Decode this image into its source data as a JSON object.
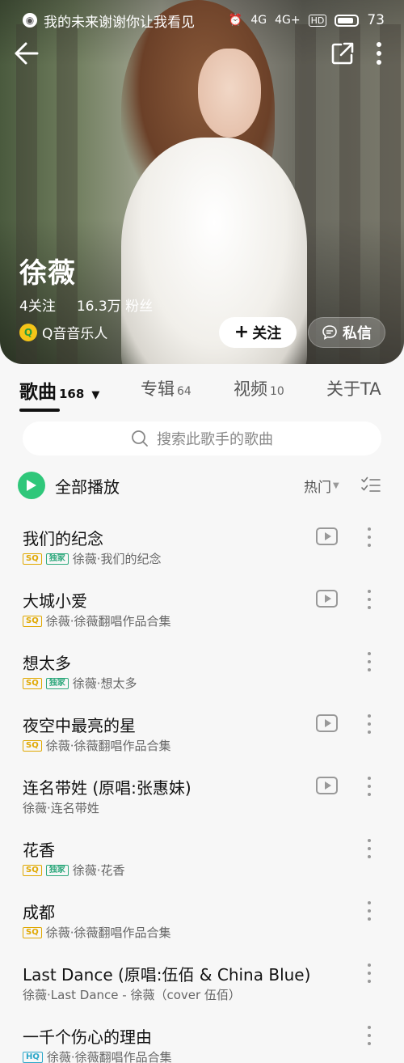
{
  "status_bar": {
    "notification_text": "我的未来谢谢你让我看见",
    "signal_1": "4G",
    "signal_2": "4G+",
    "hd": "HD",
    "battery": "73"
  },
  "artist": {
    "name": "徐薇",
    "following": "4关注",
    "fans": "16.3万 粉丝",
    "badge": "Q音音乐人",
    "follow_label": "关注",
    "message_label": "私信"
  },
  "tabs": [
    {
      "label": "歌曲",
      "count": "168",
      "active": true
    },
    {
      "label": "专辑",
      "count": "64"
    },
    {
      "label": "视频",
      "count": "10"
    },
    {
      "label": "关于TA",
      "count": ""
    }
  ],
  "search": {
    "placeholder": "搜索此歌手的歌曲"
  },
  "play_all": {
    "label": "全部播放",
    "sort_label": "热门"
  },
  "songs": [
    {
      "title": "我们的纪念",
      "tags": [
        "SQ",
        "独家"
      ],
      "subtitle": "徐薇·我们的纪念",
      "has_mv": true
    },
    {
      "title": "大城小爱",
      "tags": [
        "SQ"
      ],
      "subtitle": "徐薇·徐薇翻唱作品合集",
      "has_mv": true
    },
    {
      "title": "想太多",
      "tags": [
        "SQ",
        "独家"
      ],
      "subtitle": "徐薇·想太多",
      "has_mv": false
    },
    {
      "title": "夜空中最亮的星",
      "tags": [
        "SQ"
      ],
      "subtitle": "徐薇·徐薇翻唱作品合集",
      "has_mv": true
    },
    {
      "title": "连名带姓 (原唱:张惠妹)",
      "tags": [],
      "subtitle": "徐薇·连名带姓",
      "has_mv": true
    },
    {
      "title": "花香",
      "tags": [
        "SQ",
        "独家"
      ],
      "subtitle": "徐薇·花香",
      "has_mv": false
    },
    {
      "title": "成都",
      "tags": [
        "SQ"
      ],
      "subtitle": "徐薇·徐薇翻唱作品合集",
      "has_mv": false
    },
    {
      "title": "Last Dance (原唱:伍佰 & China Blue)",
      "tags": [],
      "subtitle": "徐薇·Last Dance - 徐薇（cover 伍佰）",
      "has_mv": false
    },
    {
      "title": "一千个伤心的理由",
      "tags": [
        "HQ"
      ],
      "subtitle": "徐薇·徐薇翻唱作品合集",
      "has_mv": false
    }
  ],
  "colors": {
    "accent_green": "#2fc77a",
    "sq_tag": "#e0a800",
    "hq_tag": "#2aa7c9",
    "exclusive_tag": "#2fa97d"
  }
}
